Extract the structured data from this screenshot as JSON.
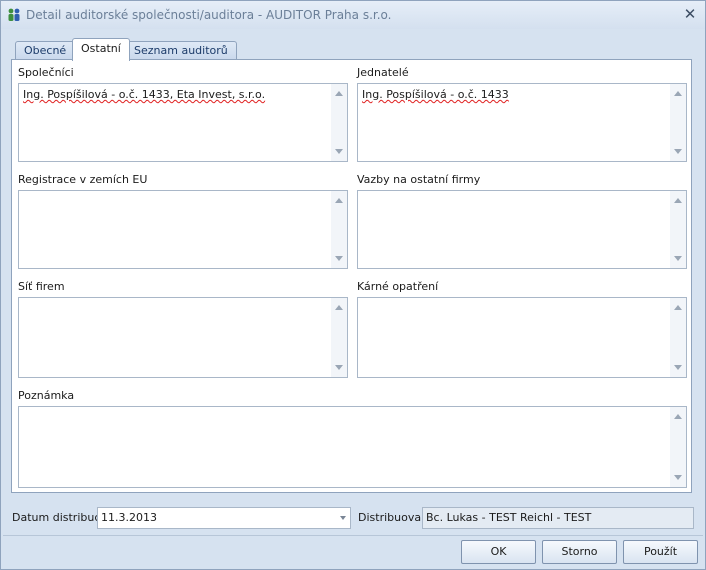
{
  "window": {
    "title": "Detail auditorské společnosti/auditora - AUDITOR Praha s.r.o."
  },
  "tabs": [
    {
      "label": "Obecné",
      "active": false
    },
    {
      "label": "Ostatní",
      "active": true
    },
    {
      "label": "Seznam auditorů",
      "active": false
    }
  ],
  "fields": {
    "spolecnici": {
      "label": "Společníci",
      "value": "Ing. Pospíšilová - o.č. 1433, Eta Invest, s.r.o."
    },
    "jednatele": {
      "label": "Jednatelé",
      "value": "Ing. Pospíšilová - o.č. 1433"
    },
    "registrace": {
      "label": "Registrace v zemích EU",
      "value": ""
    },
    "vazby": {
      "label": "Vazby na ostatní firmy",
      "value": ""
    },
    "sit": {
      "label": "Síť firem",
      "value": ""
    },
    "karne": {
      "label": "Kárné opatření",
      "value": ""
    },
    "poznamka": {
      "label": "Poznámka",
      "value": ""
    }
  },
  "footer": {
    "datum_label": "Datum distribuce",
    "datum_value": "11.3.2013",
    "distribuoval_label": "Distribuoval",
    "distribuoval_value": "Bc. Lukas - TEST Reichl  - TEST"
  },
  "buttons": {
    "ok": "OK",
    "storno": "Storno",
    "pouzit": "Použít"
  },
  "colors": {
    "accent": "#d6e2f0",
    "border": "#8fa3bd"
  }
}
